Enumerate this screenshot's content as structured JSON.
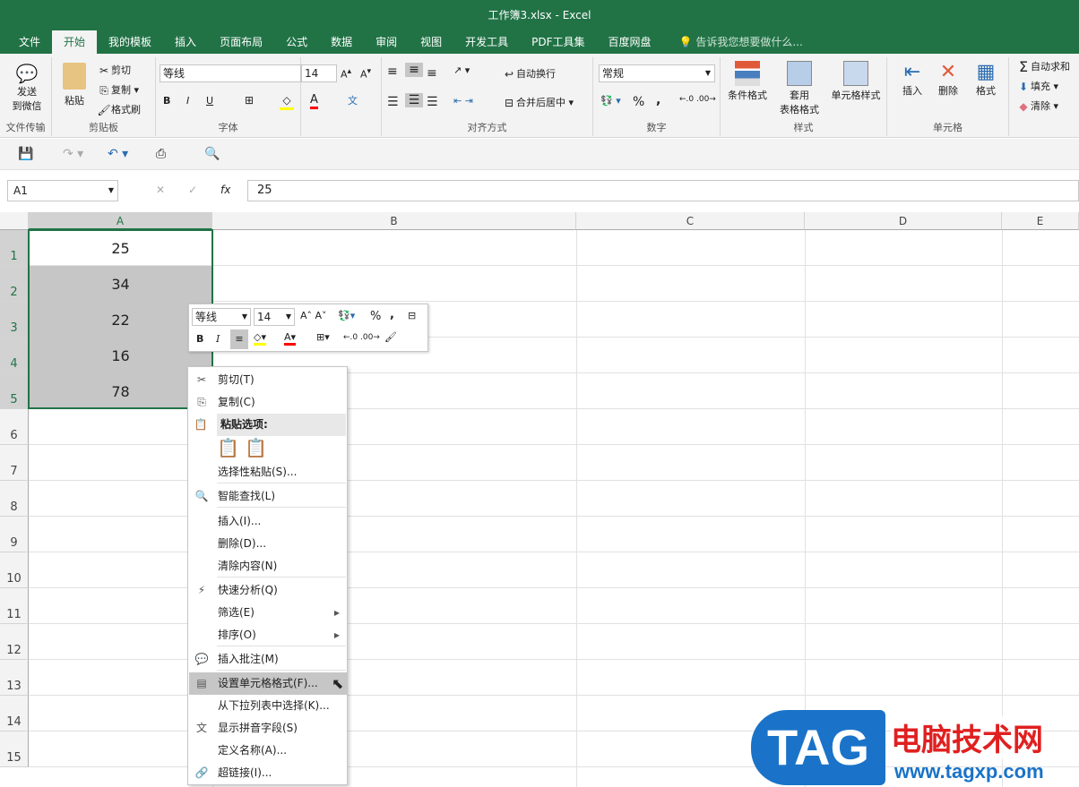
{
  "window_title": "工作簿3.xlsx - Excel",
  "tabs": [
    "文件",
    "开始",
    "我的模板",
    "插入",
    "页面布局",
    "公式",
    "数据",
    "审阅",
    "视图",
    "开发工具",
    "PDF工具集",
    "百度网盘"
  ],
  "active_tab": "开始",
  "tell_me": "告诉我您想要做什么...",
  "ribbon": {
    "file_transfer": {
      "send": "发送\n到微信",
      "label": "文件传输"
    },
    "clipboard": {
      "paste": "粘贴",
      "cut": "剪切",
      "copy": "复制",
      "format_painter": "格式刷",
      "label": "剪贴板"
    },
    "font": {
      "name": "等线",
      "size": "14",
      "bold": "B",
      "italic": "I",
      "underline": "U",
      "label": "字体",
      "fill_color": "#ffff00",
      "font_color": "#ff0000"
    },
    "alignment": {
      "wrap": "自动换行",
      "merge": "合并后居中",
      "label": "对齐方式"
    },
    "number": {
      "format": "常规",
      "percent": "%",
      "comma": ",",
      "label": "数字"
    },
    "styles": {
      "conditional": "条件格式",
      "table": "套用\n表格格式",
      "cell_styles": "单元格样式",
      "label": "样式"
    },
    "cells": {
      "insert": "插入",
      "delete": "删除",
      "format": "格式",
      "label": "单元格"
    },
    "editing": {
      "autosum": "自动求和",
      "fill": "填充",
      "clear": "清除"
    }
  },
  "name_box": "A1",
  "formula": "25",
  "fx": "fx",
  "columns": [
    "A",
    "B",
    "C",
    "D",
    "E"
  ],
  "rows": [
    "1",
    "2",
    "3",
    "4",
    "5",
    "6",
    "7",
    "8",
    "9",
    "10",
    "11",
    "12",
    "13",
    "14",
    "15"
  ],
  "cells": {
    "A": [
      "25",
      "34",
      "22",
      "16",
      "78"
    ]
  },
  "mini_toolbar": {
    "font": "等线",
    "size": "14",
    "bold": "B",
    "italic": "I",
    "percent": "%",
    "comma": ","
  },
  "context_menu": {
    "items": [
      {
        "label": "剪切(T)",
        "icon": "scissors-icon"
      },
      {
        "label": "复制(C)",
        "icon": "copy-icon"
      },
      {
        "label": "粘贴选项:",
        "icon": "paste-icon"
      },
      {
        "label": "选择性粘贴(S)..."
      },
      {
        "label": "智能查找(L)",
        "icon": "smart-lookup-icon"
      },
      {
        "label": "插入(I)..."
      },
      {
        "label": "删除(D)..."
      },
      {
        "label": "清除内容(N)"
      },
      {
        "label": "快速分析(Q)",
        "icon": "quick-analysis-icon"
      },
      {
        "label": "筛选(E)"
      },
      {
        "label": "排序(O)"
      },
      {
        "label": "插入批注(M)",
        "icon": "comment-icon"
      },
      {
        "label": "设置单元格格式(F)...",
        "icon": "format-cells-icon"
      },
      {
        "label": "从下拉列表中选择(K)..."
      },
      {
        "label": "显示拼音字段(S)",
        "icon": "phonetic-icon"
      },
      {
        "label": "定义名称(A)..."
      },
      {
        "label": "超链接(I)...",
        "icon": "hyperlink-icon"
      }
    ]
  },
  "watermark": {
    "logo": "TAG",
    "name": "电脑技术网",
    "url": "www.tagxp.com"
  },
  "colors": {
    "brand": "#217346",
    "selection": "#c6c6c6"
  }
}
